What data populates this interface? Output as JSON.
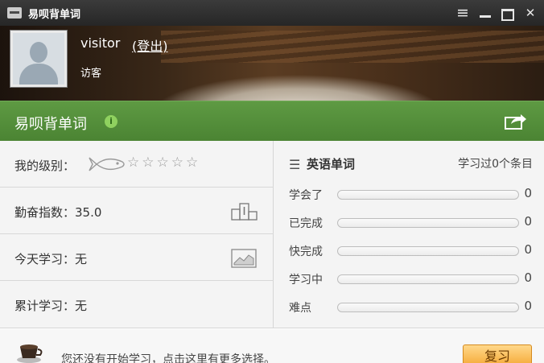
{
  "window": {
    "title": "易呗背单词",
    "controls": [
      "menu-icon",
      "minimize-icon",
      "maximize-icon",
      "close-icon"
    ]
  },
  "user": {
    "name": "visitor",
    "logout_label": "(登出)",
    "role": "访客"
  },
  "header": {
    "title": "易呗背单词",
    "info_icon_text": "i",
    "accent_color": "#4f8a37"
  },
  "stats": {
    "level_label": "我的级别：",
    "level_stars": "☆☆☆☆☆",
    "diligence_label": "勤奋指数：35.0",
    "today_label": "今天学习：无",
    "total_label": "累计学习：无"
  },
  "wordbook": {
    "title": "英语单词",
    "summary": "学习过0个条目",
    "progress": [
      {
        "label": "学会了",
        "value": 0,
        "count": "0"
      },
      {
        "label": "已完成",
        "value": 0,
        "count": "0"
      },
      {
        "label": "快完成",
        "value": 0,
        "count": "0"
      },
      {
        "label": "学习中",
        "value": 0,
        "count": "0"
      },
      {
        "label": "难点",
        "value": 0,
        "count": "0"
      }
    ]
  },
  "footer": {
    "tip": "您还没有开始学习，点击这里有更多选择。",
    "review_button": "复习"
  }
}
